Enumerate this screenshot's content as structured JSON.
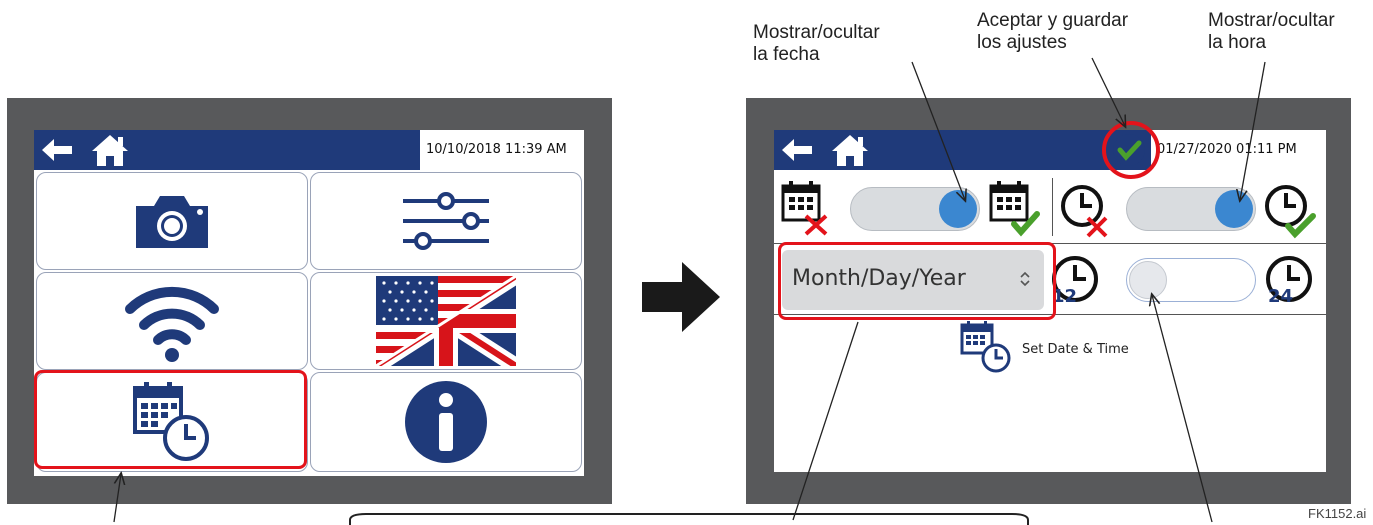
{
  "left_screen": {
    "datetime": "10/10/2018 11:39 AM",
    "nav_icons": [
      "back-arrow-icon",
      "home-icon"
    ],
    "tiles": [
      {
        "icon": "camera-icon"
      },
      {
        "icon": "sliders-icon"
      },
      {
        "icon": "wifi-icon"
      },
      {
        "icon": "us-uk-flag-icon"
      },
      {
        "icon": "calendar-clock-icon",
        "highlighted": true
      },
      {
        "icon": "info-icon"
      }
    ]
  },
  "right_screen": {
    "datetime": "01/27/2020 01:11 PM",
    "confirm_icon": "checkmark-icon",
    "date_format_select": "Month/Day/Year",
    "hour_12_label": "12",
    "hour_24_label": "24",
    "set_date_time_label": "Set Date & Time",
    "show_date_toggle_on": true,
    "show_time_toggle_on": true,
    "hour_format_toggle_on": false
  },
  "callouts": {
    "show_date": "Mostrar/ocultar la fecha",
    "show_date_line1": "Mostrar/ocultar",
    "show_date_line2": "la fecha",
    "accept": "Aceptar y guardar los ajustes",
    "accept_line1": "Aceptar y guardar",
    "accept_line2": "los ajustes",
    "show_time": "Mostrar/ocultar la hora",
    "show_time_line1": "Mostrar/ocultar",
    "show_time_line2": "la hora"
  },
  "figure_id": "FK1152.ai",
  "colors": {
    "navbar": "#1f3a7a",
    "bezel": "#58595b",
    "highlight": "#e3131b",
    "toggle_blue": "#3b87d0",
    "check_green": "#4aa02c",
    "cross_red": "#e3131b"
  }
}
